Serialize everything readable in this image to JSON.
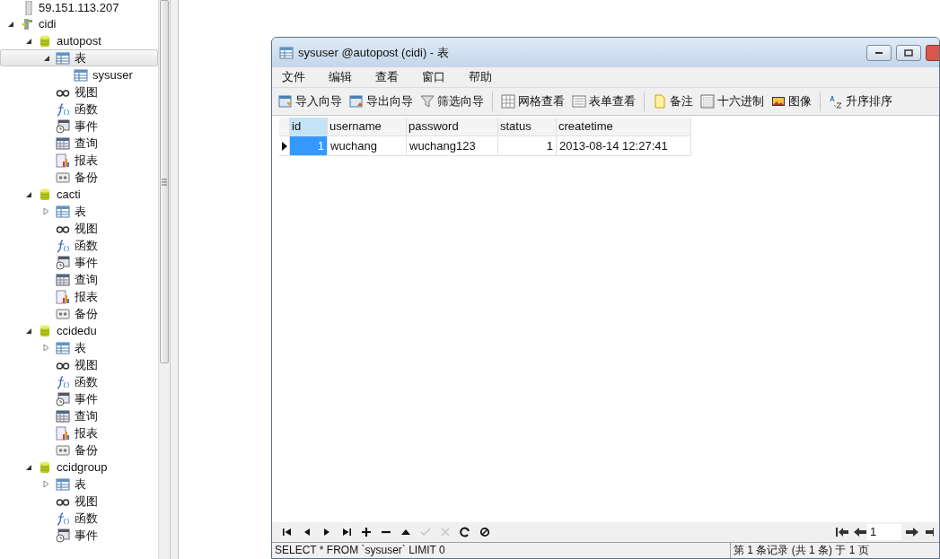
{
  "server": {
    "label": "59.151.113.207"
  },
  "tree": [
    {
      "label": "cidi",
      "kind": "connection",
      "expanded": true,
      "selected": false,
      "children": [
        {
          "label": "autopost",
          "kind": "database",
          "expanded": true,
          "selected": false,
          "children": [
            {
              "label": "表",
              "kind": "table",
              "expanded": true,
              "selected": true,
              "children": [
                {
                  "label": "sysuser",
                  "kind": "table",
                  "selected": false
                }
              ]
            },
            {
              "label": "视图",
              "kind": "view",
              "selected": false
            },
            {
              "label": "函数",
              "kind": "function",
              "selected": false
            },
            {
              "label": "事件",
              "kind": "event",
              "selected": false
            },
            {
              "label": "查询",
              "kind": "query",
              "selected": false
            },
            {
              "label": "报表",
              "kind": "report",
              "selected": false
            },
            {
              "label": "备份",
              "kind": "backup",
              "selected": false
            }
          ]
        },
        {
          "label": "cacti",
          "kind": "database",
          "expanded": true,
          "selected": false,
          "children": [
            {
              "label": "表",
              "kind": "table",
              "expanded": false,
              "selected": false
            },
            {
              "label": "视图",
              "kind": "view",
              "selected": false
            },
            {
              "label": "函数",
              "kind": "function",
              "selected": false
            },
            {
              "label": "事件",
              "kind": "event",
              "selected": false
            },
            {
              "label": "查询",
              "kind": "query",
              "selected": false
            },
            {
              "label": "报表",
              "kind": "report",
              "selected": false
            },
            {
              "label": "备份",
              "kind": "backup",
              "selected": false
            }
          ]
        },
        {
          "label": "ccidedu",
          "kind": "database",
          "expanded": true,
          "selected": false,
          "children": [
            {
              "label": "表",
              "kind": "table",
              "expanded": false,
              "selected": false
            },
            {
              "label": "视图",
              "kind": "view",
              "selected": false
            },
            {
              "label": "函数",
              "kind": "function",
              "selected": false
            },
            {
              "label": "事件",
              "kind": "event",
              "selected": false
            },
            {
              "label": "查询",
              "kind": "query",
              "selected": false
            },
            {
              "label": "报表",
              "kind": "report",
              "selected": false
            },
            {
              "label": "备份",
              "kind": "backup",
              "selected": false
            }
          ]
        },
        {
          "label": "ccidgroup",
          "kind": "database",
          "expanded": true,
          "selected": false,
          "children": [
            {
              "label": "表",
              "kind": "table",
              "expanded": false,
              "selected": false
            },
            {
              "label": "视图",
              "kind": "view",
              "selected": false
            },
            {
              "label": "函数",
              "kind": "function",
              "selected": false
            },
            {
              "label": "事件",
              "kind": "event",
              "selected": false
            }
          ]
        }
      ]
    }
  ],
  "window": {
    "title": "sysuser @autopost (cidi) - 表",
    "menu": [
      "文件",
      "编辑",
      "查看",
      "窗口",
      "帮助"
    ],
    "toolbar": [
      {
        "label": "导入向导",
        "kind": "import"
      },
      {
        "label": "导出向导",
        "kind": "export"
      },
      {
        "label": "筛选向导",
        "kind": "filter"
      },
      {
        "kind": "separator"
      },
      {
        "label": "网格查看",
        "kind": "grid"
      },
      {
        "label": "表单查看",
        "kind": "form"
      },
      {
        "kind": "separator"
      },
      {
        "label": "备注",
        "kind": "memo"
      },
      {
        "label": "十六进制",
        "kind": "hex"
      },
      {
        "label": "图像",
        "kind": "image"
      },
      {
        "kind": "separator"
      },
      {
        "label": "升序排序",
        "kind": "sort"
      }
    ],
    "grid": {
      "columns": [
        "id",
        "username",
        "password",
        "status",
        "createtime"
      ],
      "rows": [
        {
          "selected": true,
          "cells": [
            "1",
            "wuchang",
            "wuchang123",
            "1",
            "2013-08-14 12:27:41"
          ]
        }
      ]
    },
    "nav": [
      {
        "kind": "first",
        "disabled": false
      },
      {
        "kind": "prev",
        "disabled": false
      },
      {
        "kind": "next",
        "disabled": false
      },
      {
        "kind": "last",
        "disabled": false
      },
      {
        "kind": "add",
        "disabled": false
      },
      {
        "kind": "delete",
        "disabled": false
      },
      {
        "kind": "up",
        "disabled": false
      },
      {
        "kind": "apply",
        "disabled": true
      },
      {
        "kind": "cancel",
        "disabled": true
      },
      {
        "kind": "refresh",
        "disabled": false
      },
      {
        "kind": "stop",
        "disabled": false
      }
    ],
    "page": "1",
    "status": {
      "sql": "SELECT * FROM `sysuser` LIMIT 0",
      "records": "第 1 条记录 (共 1 条) 于 1 页"
    }
  }
}
